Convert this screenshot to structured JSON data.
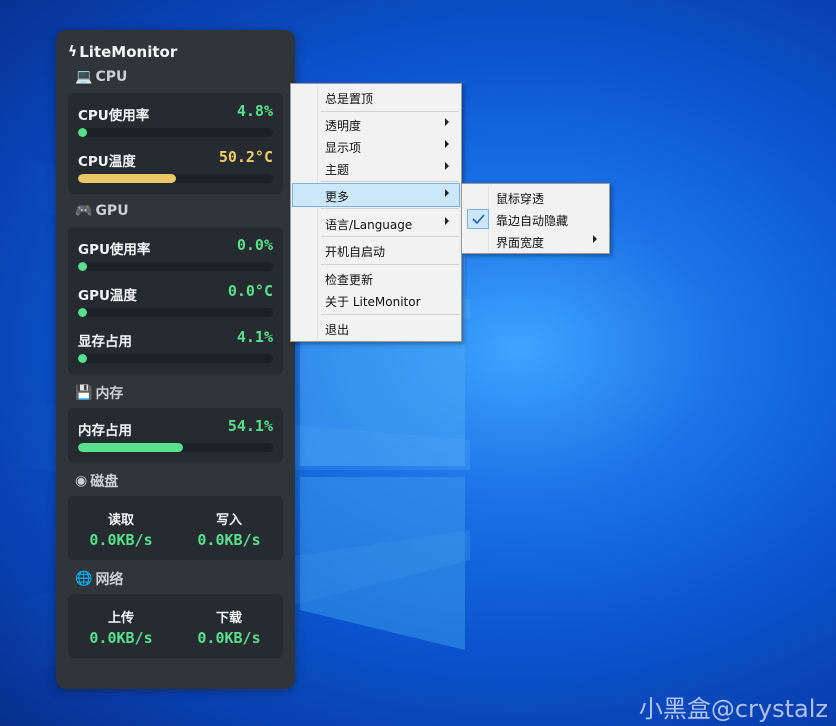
{
  "app": {
    "title": "LiteMonitor",
    "sections": {
      "cpu": "CPU",
      "gpu": "GPU",
      "memory": "内存",
      "disk": "磁盘",
      "network": "网络"
    },
    "cpu": [
      {
        "name": "CPU使用率",
        "value": "4.8%",
        "level": 0.048,
        "color": "#58e08f"
      },
      {
        "name": "CPU温度",
        "value": "50.2°C",
        "level": 0.502,
        "color": "#e8c766"
      }
    ],
    "gpu": [
      {
        "name": "GPU使用率",
        "value": "0.0%",
        "level": 0.0,
        "color": "#58e08f"
      },
      {
        "name": "GPU温度",
        "value": "0.0°C",
        "level": 0.0,
        "color": "#58e08f"
      },
      {
        "name": "显存占用",
        "value": "4.1%",
        "level": 0.041,
        "color": "#58e08f"
      }
    ],
    "memory": [
      {
        "name": "内存占用",
        "value": "54.1%",
        "level": 0.541,
        "color": "#58e08f"
      }
    ],
    "disk": {
      "read_label": "读取",
      "read_value": "0.0KB/s",
      "write_label": "写入",
      "write_value": "0.0KB/s"
    },
    "network": {
      "up_label": "上传",
      "up_value": "0.0KB/s",
      "down_label": "下载",
      "down_value": "0.0KB/s"
    }
  },
  "context_menu": {
    "items": [
      {
        "label": "总是置顶",
        "submenu": false
      },
      {
        "label": "透明度",
        "submenu": true
      },
      {
        "label": "显示项",
        "submenu": true
      },
      {
        "label": "主题",
        "submenu": true
      },
      {
        "label": "更多",
        "submenu": true,
        "highlighted": true
      },
      {
        "label": "语言/Language",
        "submenu": true
      },
      {
        "label": "开机自启动",
        "submenu": false
      },
      {
        "label": "检查更新",
        "submenu": false
      },
      {
        "label": "关于 LiteMonitor",
        "submenu": false
      },
      {
        "label": "退出",
        "submenu": false
      }
    ]
  },
  "submenu_more": {
    "items": [
      {
        "label": "鼠标穿透",
        "checked": false,
        "submenu": false
      },
      {
        "label": "靠边自动隐藏",
        "checked": true,
        "submenu": false
      },
      {
        "label": "界面宽度",
        "checked": false,
        "submenu": true
      }
    ]
  },
  "watermark": "小黑盒@crystalz",
  "colors": {
    "accent_green": "#58e08f",
    "accent_yellow": "#f2cc6b",
    "panel_bg": "#2f3539",
    "menu_highlight": "#cce6fa"
  }
}
